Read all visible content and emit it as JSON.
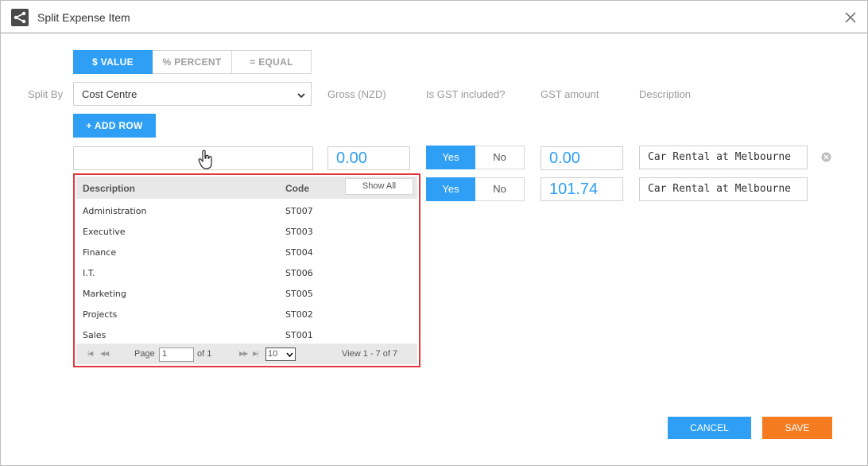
{
  "window": {
    "title": "Split Expense Item",
    "icon": "share-icon",
    "close_icon": "close-icon"
  },
  "tabs": [
    {
      "label": "$ VALUE",
      "active": true
    },
    {
      "label": "% PERCENT",
      "active": false
    },
    {
      "label": "= EQUAL",
      "active": false
    }
  ],
  "split_by": {
    "label": "Split By",
    "selected": "Cost Centre"
  },
  "columns": {
    "gross": "Gross (NZD)",
    "gst_included": "Is GST included?",
    "gst_amount": "GST amount",
    "description": "Description"
  },
  "add_row_label": "+ ADD ROW",
  "rows": [
    {
      "cost_centre": "",
      "gross": "0.00",
      "yes": "Yes",
      "no": "No",
      "gst_amount": "0.00",
      "description": "Car Rental at Melbourne"
    },
    {
      "yes": "Yes",
      "no": "No",
      "gst_amount": "101.74",
      "description": "Car Rental at Melbourne"
    }
  ],
  "dropdown": {
    "header_description": "Description",
    "header_code": "Code",
    "show_all_label": "Show All",
    "items": [
      {
        "description": "Administration",
        "code": "ST007"
      },
      {
        "description": "Executive",
        "code": "ST003"
      },
      {
        "description": "Finance",
        "code": "ST004"
      },
      {
        "description": "I.T.",
        "code": "ST006"
      },
      {
        "description": "Marketing",
        "code": "ST005"
      },
      {
        "description": "Projects",
        "code": "ST002"
      },
      {
        "description": "Sales",
        "code": "ST001"
      }
    ],
    "pager": {
      "page_label": "Page",
      "page_value": "1",
      "of_label": "of 1",
      "rows_per_page": "10",
      "view_label": "View 1 - 7 of 7"
    }
  },
  "footer": {
    "cancel_label": "CANCEL",
    "save_label": "SAVE"
  },
  "colors": {
    "accent": "#2f9ff5",
    "save": "#f47b20",
    "dropdown_border": "#e0383e"
  }
}
